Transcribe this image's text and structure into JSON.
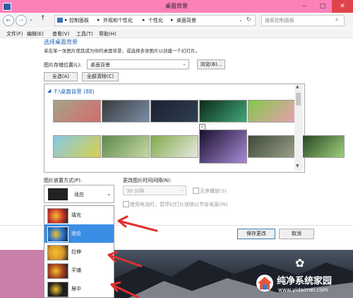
{
  "window": {
    "title": "桌面背景",
    "controls": [
      "minimize-icon",
      "maximize-icon",
      "close-icon"
    ]
  },
  "nav": {
    "crumbs": [
      "控制面板",
      "外观和个性化",
      "个性化",
      "桌面背景"
    ],
    "search_placeholder": "搜索控制面板"
  },
  "menu": [
    "文件(F)",
    "编辑(E)",
    "查看(V)",
    "工具(T)",
    "帮助(H)"
  ],
  "content": {
    "heading": "选择桌面背景",
    "description": "单击某一张图片使其成为你的桌面背景，或选择多张图片以创建一个幻灯片。",
    "location_label": "图片存储位置(L):",
    "location_value": "桌面背景",
    "browse_button": "浏览(B)...",
    "select_all_button": "全选(A)",
    "clear_all_button": "全部清除(C)",
    "folder_label": "F:\\桌面背景 (88)",
    "thumbs_row1": [
      {
        "name": "thumb-cartoon",
        "colors": [
          "#a4a48a",
          "#d56b6b"
        ]
      },
      {
        "name": "thumb-lake-mountain",
        "colors": [
          "#3a3a3a",
          "#7a8fa8"
        ]
      },
      {
        "name": "thumb-dark-space",
        "colors": [
          "#1a2230",
          "#2f3e52"
        ]
      },
      {
        "name": "thumb-green-plant",
        "colors": [
          "#0d2a18",
          "#41a87a"
        ]
      },
      {
        "name": "thumb-green-cartoon",
        "colors": [
          "#83c84a",
          "#e8a0b2"
        ]
      }
    ],
    "thumbs_row2": [
      {
        "name": "thumb-yellow-flower",
        "colors": [
          "#86c8e8",
          "#d8d04a"
        ]
      },
      {
        "name": "thumb-green-sprout",
        "colors": [
          "#5d8a4a",
          "#c6d9a4"
        ]
      },
      {
        "name": "thumb-daisies",
        "colors": [
          "#7faa4a",
          "#e8e8e0"
        ]
      },
      {
        "name": "thumb-purple-burst",
        "colors": [
          "#1a1030",
          "#a98ad6"
        ],
        "checked": true
      },
      {
        "name": "thumb-kittens",
        "colors": [
          "#3e4a38",
          "#9aa08a"
        ]
      },
      {
        "name": "thumb-blossom",
        "colors": [
          "#1e3a1e",
          "#9ed07a"
        ]
      }
    ],
    "position_label": "图片放置方式(P):",
    "position_value": "适应",
    "interval_label": "更改图片时间间隔(N):",
    "interval_value": "30 分钟",
    "shuffle_label": "无序播放(S)",
    "battery_label": "使用电池时，暂停幻灯片放映以节省电源(W)",
    "save_button": "保存更改",
    "cancel_button": "取消"
  },
  "dropdown_options": [
    {
      "label": "填充",
      "selected": false
    },
    {
      "label": "适应",
      "selected": true
    },
    {
      "label": "拉伸",
      "selected": false
    },
    {
      "label": "平铺",
      "selected": false
    },
    {
      "label": "居中",
      "selected": false
    }
  ],
  "colors": {
    "title_bar": "#fe80b9",
    "selection": "#3a8ee6",
    "arrow": "#e03030",
    "heading": "#1e63b7"
  },
  "watermark": {
    "name": "纯净系统家园",
    "url": "www.yidaimei.com"
  }
}
